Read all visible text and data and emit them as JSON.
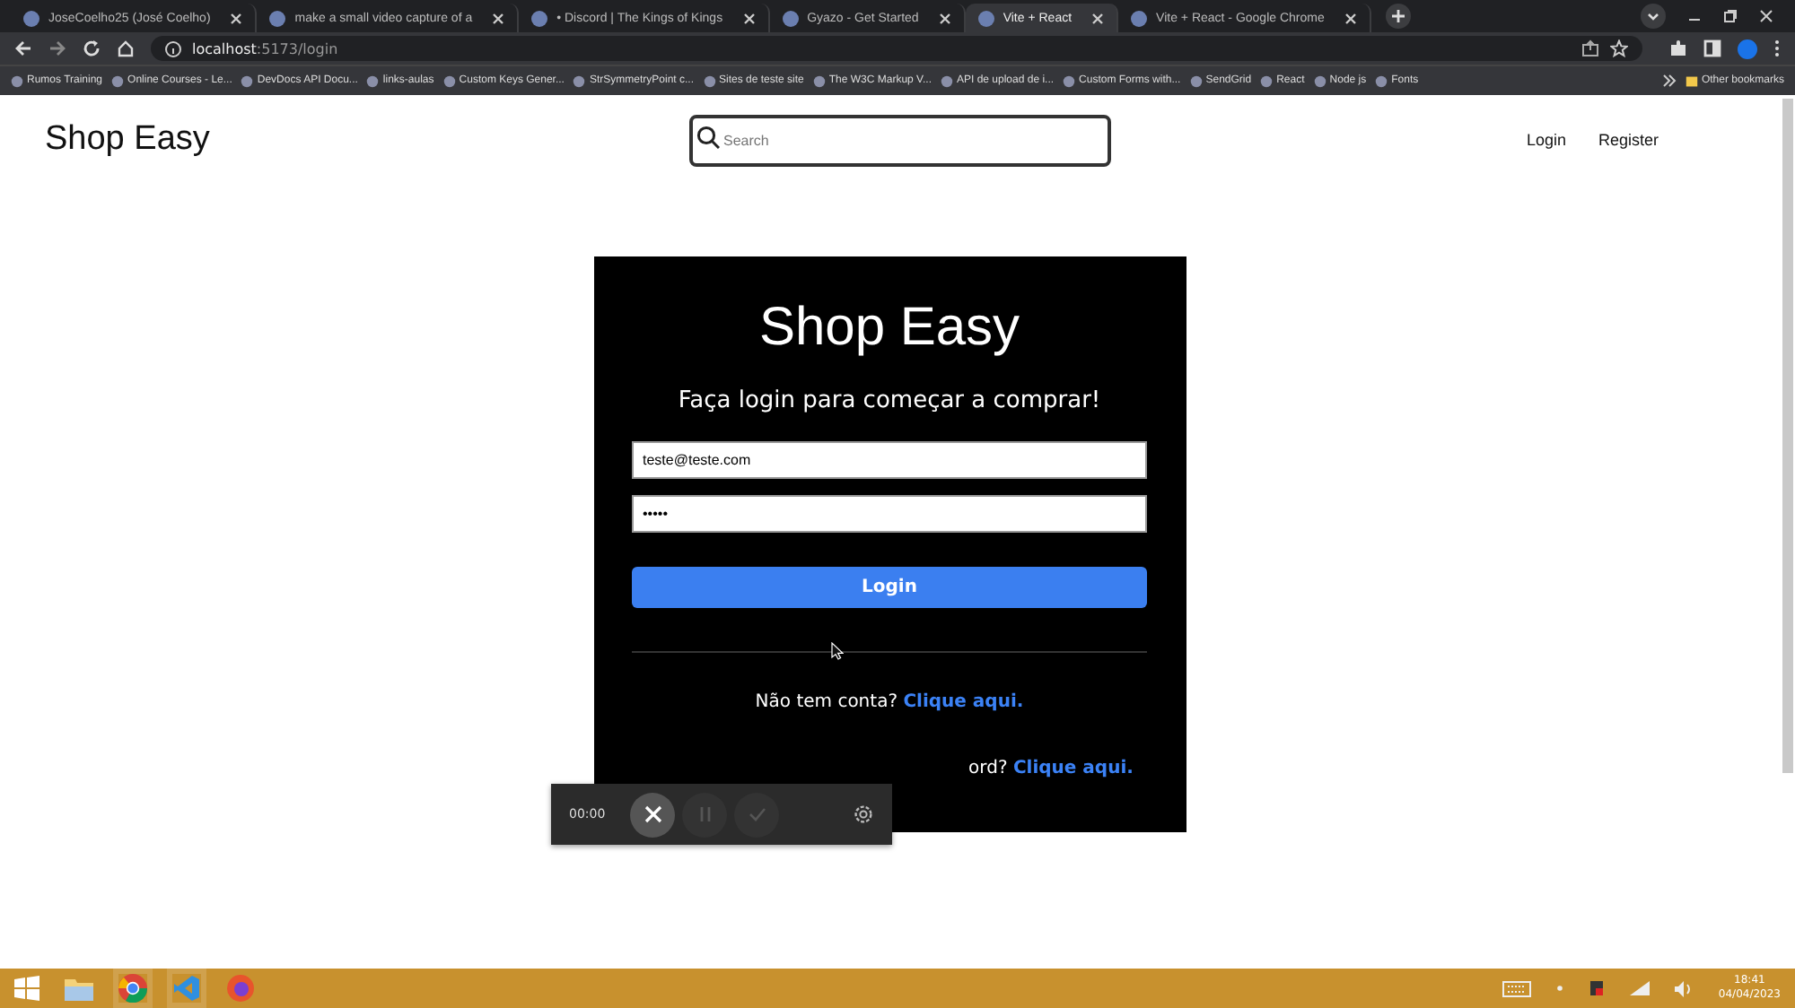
{
  "browser": {
    "tabs": [
      {
        "title": "JoseCoelho25 (José Coelho)",
        "selected": false
      },
      {
        "title": "make a small video capture of a",
        "selected": false
      },
      {
        "title": "• Discord | The Kings of Kings",
        "selected": false
      },
      {
        "title": "Gyazo - Get Started",
        "selected": false
      },
      {
        "title": "Vite + React",
        "selected": true
      },
      {
        "title": "Vite + React - Google Chrome",
        "selected": false
      }
    ],
    "address": {
      "host": "localhost",
      "path": ":5173/login"
    },
    "bookmarks": [
      "Rumos Training",
      "Online Courses - Le...",
      "DevDocs API Docu...",
      "links-aulas",
      "Custom Keys Gener...",
      "StrSymmetryPoint c...",
      "Sites de teste site",
      "The W3C Markup V...",
      "API de upload de i...",
      "Custom Forms with...",
      "SendGrid",
      "React",
      "Node js",
      "Fonts"
    ],
    "other_bookmarks": "Other bookmarks"
  },
  "header": {
    "logo": "Shop Easy",
    "search": {
      "placeholder": "Search"
    },
    "links": [
      "Login",
      "Register"
    ]
  },
  "login_card": {
    "title": "Shop Easy",
    "subtitle": "Faça login para começar a comprar!",
    "email": {
      "value": "teste@teste.com"
    },
    "password": {
      "value": "•••••"
    },
    "submit": "Login",
    "signup_text": "Não tem conta?",
    "signup_link": "Clique aqui.",
    "forgot_text": "ord?",
    "forgot_link": "Clique aqui."
  },
  "recorder": {
    "time": "00:00"
  },
  "taskbar": {
    "time": "18:41",
    "date": "04/04/2023"
  }
}
